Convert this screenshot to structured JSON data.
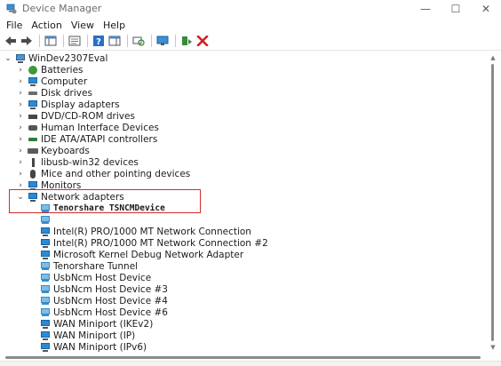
{
  "window": {
    "title": "Device Manager",
    "controls": {
      "minimize": "—",
      "maximize": "☐",
      "close": "✕"
    }
  },
  "menu": [
    "File",
    "Action",
    "View",
    "Help"
  ],
  "toolbar_icons": [
    "back-icon",
    "forward-icon",
    "show-hide-console-tree-icon",
    "properties-icon",
    "help-icon",
    "action-pane-icon",
    "scan-hardware-icon",
    "monitor-icon",
    "update-driver-icon",
    "uninstall-icon"
  ],
  "tree": {
    "root": "WinDev2307Eval",
    "categories": [
      {
        "label": "Batteries",
        "icon": "battery-icon",
        "expanded": false
      },
      {
        "label": "Computer",
        "icon": "computer-icon",
        "expanded": false
      },
      {
        "label": "Disk drives",
        "icon": "disk-drive-icon",
        "expanded": false
      },
      {
        "label": "Display adapters",
        "icon": "display-adapter-icon",
        "expanded": false
      },
      {
        "label": "DVD/CD-ROM drives",
        "icon": "dvd-icon",
        "expanded": false
      },
      {
        "label": "Human Interface Devices",
        "icon": "hid-icon",
        "expanded": false
      },
      {
        "label": "IDE ATA/ATAPI controllers",
        "icon": "ide-controller-icon",
        "expanded": false
      },
      {
        "label": "Keyboards",
        "icon": "keyboard-icon",
        "expanded": false
      },
      {
        "label": "libusb-win32 devices",
        "icon": "usb-icon",
        "expanded": false
      },
      {
        "label": "Mice and other pointing devices",
        "icon": "mouse-icon",
        "expanded": false
      },
      {
        "label": "Monitors",
        "icon": "monitor-icon",
        "expanded": false
      },
      {
        "label": "Network adapters",
        "icon": "network-adapter-icon",
        "expanded": true
      }
    ],
    "network_adapters": [
      "Tenorshare TSNCMDevice",
      "",
      "Intel(R) PRO/1000 MT Network Connection",
      "Intel(R) PRO/1000 MT Network Connection #2",
      "Microsoft Kernel Debug Network Adapter",
      "Tenorshare Tunnel",
      "UsbNcm Host Device",
      "UsbNcm Host Device #3",
      "UsbNcm Host Device #4",
      "UsbNcm Host Device #6",
      "WAN Miniport (IKEv2)",
      "WAN Miniport (IP)",
      "WAN Miniport (IPv6)"
    ]
  },
  "colors": {
    "highlight_border": "#d22b2b",
    "accent": "#2a8ad4"
  }
}
